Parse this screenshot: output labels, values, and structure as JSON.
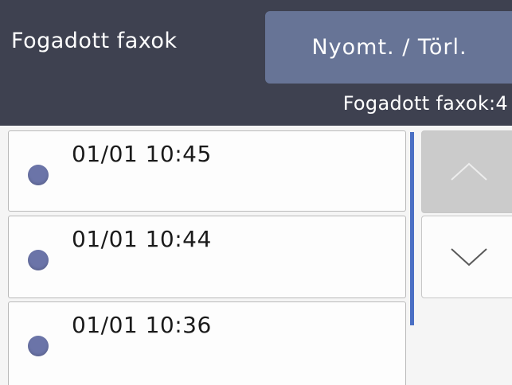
{
  "header": {
    "title": "Fogadott faxok",
    "action_button": "Nyomt. / Törl.",
    "count_label": "Fogadott faxok:4"
  },
  "list": {
    "items": [
      {
        "label": "01/01 10:45",
        "icon": "status-dot-icon"
      },
      {
        "label": "01/01 10:44",
        "icon": "status-dot-icon"
      },
      {
        "label": "01/01 10:36",
        "icon": "status-dot-icon"
      }
    ]
  },
  "scroll": {
    "up_icon": "chevron-up-icon",
    "down_icon": "chevron-down-icon",
    "up_enabled": false,
    "down_enabled": true
  },
  "colors": {
    "header_bg": "#3e4150",
    "button_bg": "#677496",
    "dot": "#6b74a8",
    "scrollbar": "#4a6fc4"
  }
}
